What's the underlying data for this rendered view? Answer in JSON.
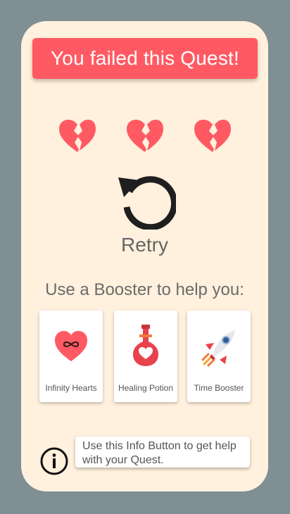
{
  "banner": {
    "text": "You failed this Quest!"
  },
  "hearts": [
    {
      "icon": "broken-heart-icon"
    },
    {
      "icon": "broken-heart-icon"
    },
    {
      "icon": "broken-heart-icon"
    }
  ],
  "retry": {
    "icon": "retry-icon",
    "label": "Retry"
  },
  "boosters": {
    "heading": "Use a Booster to help you:",
    "items": [
      {
        "label": "Infinity Hearts",
        "icon": "infinity-heart-icon"
      },
      {
        "label": "Healing Potion",
        "icon": "healing-potion-icon"
      },
      {
        "label": "Time Booster",
        "icon": "rocket-icon"
      }
    ]
  },
  "info": {
    "icon": "info-icon",
    "tooltip": "Use this Info Button to get help with your Quest."
  },
  "colors": {
    "background": "#7f8f93",
    "card": "#fff1dd",
    "banner": "#ff5a63",
    "heart": "#ff5a63"
  }
}
